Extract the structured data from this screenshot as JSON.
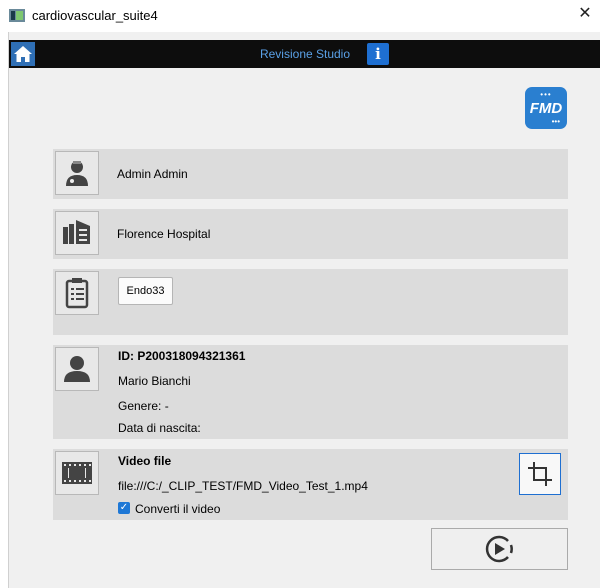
{
  "window": {
    "title": "cardiovascular_suite4",
    "close_glyph": "✕"
  },
  "topbar": {
    "title": "Revisione Studio",
    "home_icon": "home-icon",
    "info_icon": "info-icon",
    "info_glyph": "i"
  },
  "logo": {
    "text": "FMD",
    "dots": "•••"
  },
  "user": {
    "name": "Admin  Admin",
    "icon": "doctor-icon"
  },
  "hospital": {
    "name": "Florence Hospital",
    "icon": "hospital-building-icon"
  },
  "protocol": {
    "button_label": "Endo33",
    "icon": "clipboard-icon"
  },
  "patient": {
    "id_label": "ID: P200318094321361",
    "name": "Mario  Bianchi",
    "gender": "Genere: -",
    "birthdate": "Data di nascita:",
    "icon": "person-icon"
  },
  "video": {
    "heading": "Video file",
    "path": "file:///C:/_CLIP_TEST/FMD_Video_Test_1.mp4",
    "convert_label": "Converti il video",
    "convert_checked": true,
    "checkmark": "✓",
    "icon": "film-icon",
    "crop_icon": "crop-icon"
  },
  "actions": {
    "play_icon": "play-circle-icon"
  },
  "colors": {
    "accent": "#1e6fd1",
    "topbar_bg": "#0d0d0d",
    "topbar_text": "#5aa0e6",
    "logo_bg": "#2a7fd0"
  }
}
